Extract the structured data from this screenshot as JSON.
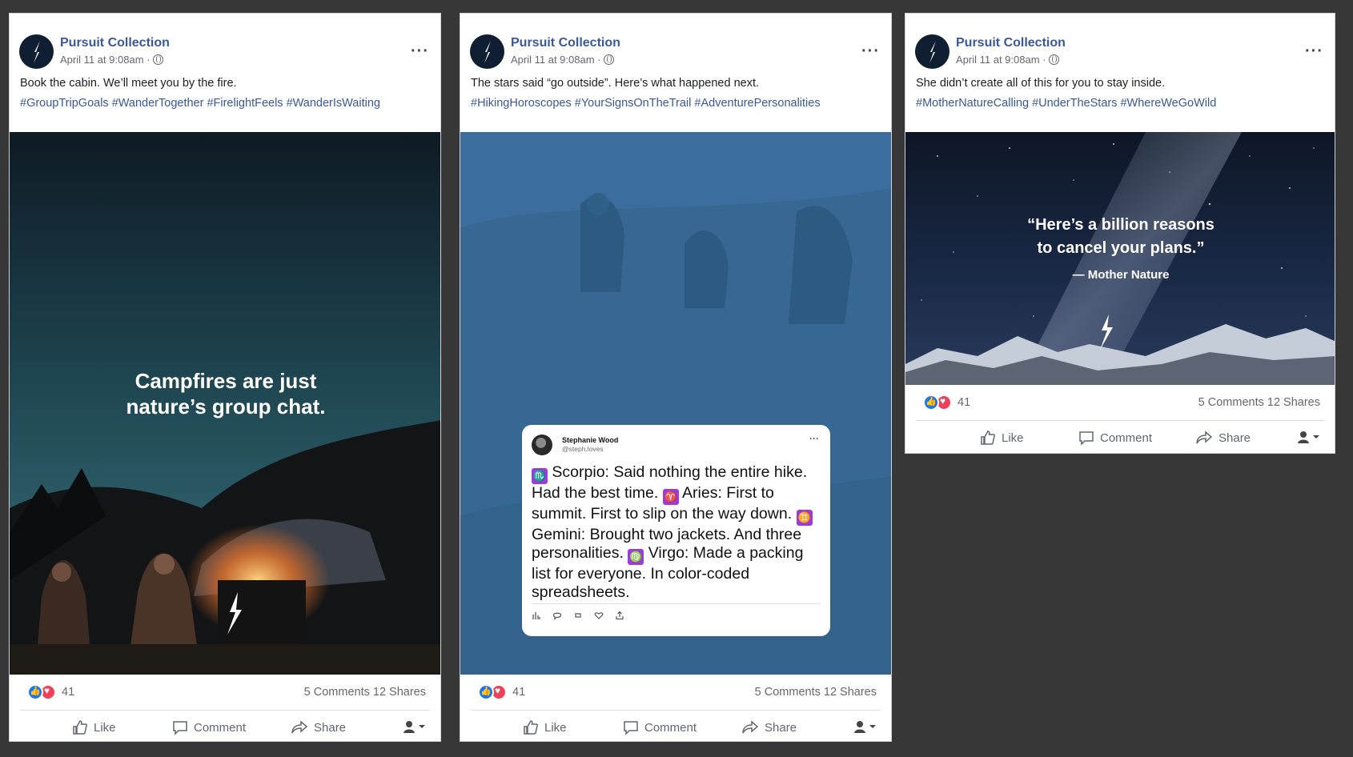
{
  "colors": {
    "page_bg": "#373737",
    "page_name": "#3b5998",
    "hashtag": "#385898",
    "post2_tint": "#3a6d9e",
    "tweet_zodiac_badge": "#9c3bd6",
    "reaction_like": "#1877f2",
    "reaction_love": "#f33e58"
  },
  "posts": [
    {
      "page_name": "Pursuit Collection",
      "date": "April 11 at 9:08am",
      "more": "···",
      "caption": "Book the cabin. We’ll meet you by the fire.",
      "hashtags": "#GroupTripGoals #WanderTogether #FirelightFeels #WanderIsWaiting",
      "image_text_line1": "Campfires are just",
      "image_text_line2": "nature’s group chat.",
      "reaction_count": "41",
      "stats": "5 Comments  12 Shares",
      "actions": {
        "like": "Like",
        "comment": "Comment",
        "share": "Share"
      }
    },
    {
      "page_name": "Pursuit Collection",
      "date": "April 11 at 9:08am",
      "more": "···",
      "caption": "The stars said “go outside”. Here’s what happened next.",
      "hashtags": "#HikingHoroscopes #YourSignsOnTheTrail #AdventurePersonalities",
      "tweet": {
        "name": "Stephanie Wood",
        "handle": "@steph.loves",
        "more": "···",
        "scorpio": "Scorpio: Said nothing the entire hike. Had the best time.",
        "aries": "Aries: First to summit. First to slip on the way down.",
        "gemini": "Gemini: Brought two jackets. And three personalities.",
        "virgo": "Virgo: Made a packing list for everyone. In color-coded spreadsheets.",
        "glyph_scorpio": "♏",
        "glyph_aries": "♈",
        "glyph_gemini": "♊",
        "glyph_virgo": "♍"
      },
      "reaction_count": "41",
      "stats": "5 Comments  12 Shares",
      "actions": {
        "like": "Like",
        "comment": "Comment",
        "share": "Share"
      }
    },
    {
      "page_name": "Pursuit Collection",
      "date": "April 11 at 9:08am",
      "more": "···",
      "caption": "She didn’t create all of this for you to stay inside.",
      "hashtags": "#MotherNatureCalling #UnderTheStars #WhereWeGoWild",
      "quote_line1": "“Here’s a billion reasons",
      "quote_line2": "to cancel your plans.”",
      "quote_attrib": "— Mother Nature",
      "reaction_count": "41",
      "stats": "5 Comments  12 Shares",
      "actions": {
        "like": "Like",
        "comment": "Comment",
        "share": "Share"
      }
    }
  ]
}
